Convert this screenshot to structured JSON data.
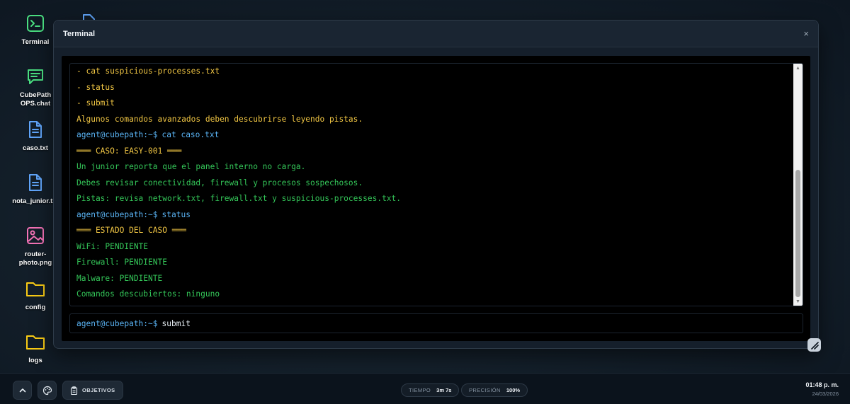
{
  "desktop": {
    "icons": [
      {
        "label": "Terminal",
        "icon": "terminal-icon",
        "color": "#4ade80"
      },
      {
        "label": "CubePath OPS.chat",
        "icon": "chat-icon",
        "color": "#4ade80"
      },
      {
        "label": "caso.txt",
        "icon": "file-icon",
        "color": "#60a5fa"
      },
      {
        "label": "nota_junior.txt",
        "icon": "file-icon",
        "color": "#60a5fa"
      },
      {
        "label": "router-photo.png",
        "icon": "image-icon",
        "color": "#f472b6"
      },
      {
        "label": "config",
        "icon": "folder-icon",
        "color": "#facc15"
      },
      {
        "label": "logs",
        "icon": "folder-icon",
        "color": "#facc15"
      }
    ]
  },
  "window": {
    "title": "Terminal",
    "close_glyph": "×"
  },
  "terminal": {
    "lines": [
      {
        "text": "- cat suspicious-processes.txt",
        "color": "yellow"
      },
      {
        "text": "- status",
        "color": "yellow"
      },
      {
        "text": "- submit",
        "color": "yellow"
      },
      {
        "text": "Algunos comandos avanzados deben descubrirse leyendo pistas.",
        "color": "yellow"
      },
      {
        "prompt": "agent@cubepath:~$",
        "text": "cat caso.txt",
        "color": "prompt"
      },
      {
        "text": "═══ CASO: EASY-001 ═══",
        "color": "yellow"
      },
      {
        "text": "Un junior reporta que el panel interno no carga.",
        "color": "green"
      },
      {
        "text": "Debes revisar conectividad, firewall y procesos sospechosos.",
        "color": "green"
      },
      {
        "text": "Pistas: revisa network.txt, firewall.txt y suspicious-processes.txt.",
        "color": "green"
      },
      {
        "prompt": "agent@cubepath:~$",
        "text": "status",
        "color": "prompt"
      },
      {
        "text": "═══ ESTADO DEL CASO ═══",
        "color": "yellow"
      },
      {
        "text": "WiFi: PENDIENTE",
        "color": "green"
      },
      {
        "text": "Firewall: PENDIENTE",
        "color": "green"
      },
      {
        "text": "Malware: PENDIENTE",
        "color": "green"
      },
      {
        "text": "Comandos descubiertos: ninguno",
        "color": "green"
      }
    ],
    "input": {
      "prompt": "agent@cubepath:~$",
      "value": "submit"
    }
  },
  "taskbar": {
    "objectives_label": "OBJETIVOS",
    "time_label": "TIEMPO",
    "time_value": "3m 7s",
    "precision_label": "PRECISIÓN",
    "precision_value": "100%",
    "clock_time": "01:48 p. m.",
    "clock_date": "24/03/2026"
  },
  "colors": {
    "yellow": "#f2c744",
    "green": "#34c759",
    "prompt": "#5ab4f5"
  }
}
